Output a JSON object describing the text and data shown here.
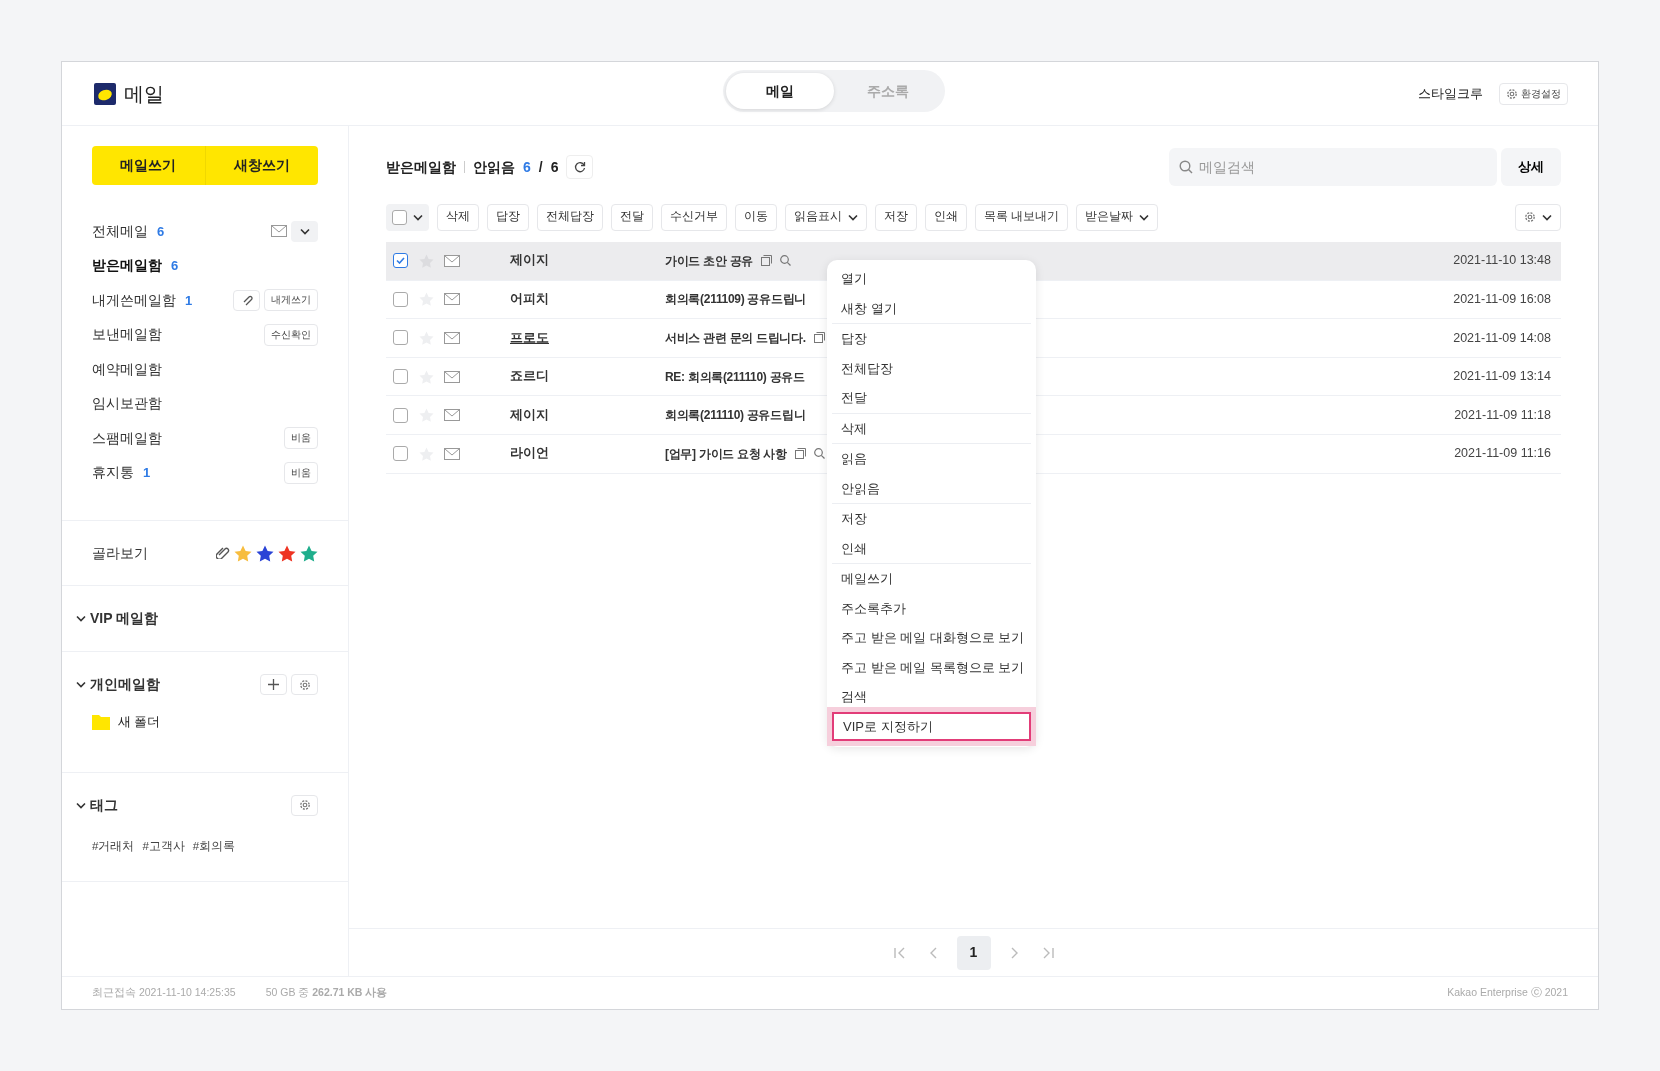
{
  "header": {
    "app_title": "메일",
    "tabs": [
      {
        "label": "메일",
        "selected": true
      },
      {
        "label": "주소록",
        "selected": false
      }
    ],
    "user": "스타일크루",
    "settings_label": "환경설정"
  },
  "sidebar": {
    "compose_buttons": [
      "메일쓰기",
      "새창쓰기"
    ],
    "folders": [
      {
        "name": "전체메일",
        "count": "6",
        "selected": false,
        "actions": [
          {
            "kind": "mail-toggle"
          },
          {
            "kind": "expand"
          }
        ]
      },
      {
        "name": "받은메일함",
        "count": "6",
        "selected": true
      },
      {
        "name": "내게쓴메일함",
        "count": "1",
        "selected": false,
        "actions": [
          {
            "kind": "attach"
          },
          {
            "kind": "text",
            "label": "내게쓰기"
          }
        ]
      },
      {
        "name": "보낸메일함",
        "selected": false,
        "actions": [
          {
            "kind": "text",
            "label": "수신확인"
          }
        ]
      },
      {
        "name": "예약메일함",
        "selected": false
      },
      {
        "name": "임시보관함",
        "selected": false
      },
      {
        "name": "스팸메일함",
        "selected": false,
        "actions": [
          {
            "kind": "text",
            "label": "비움"
          }
        ]
      },
      {
        "name": "휴지통",
        "count": "1",
        "selected": false,
        "actions": [
          {
            "kind": "text",
            "label": "비움"
          }
        ]
      }
    ],
    "filter": {
      "label": "골라보기",
      "stars": [
        {
          "color": "#f7bd3f"
        },
        {
          "color": "#2a43d6"
        },
        {
          "color": "#ee3322"
        },
        {
          "color": "#1fae8c"
        }
      ]
    },
    "sections": [
      {
        "title": "VIP 메일함",
        "expanded": true
      },
      {
        "title": "개인메일함",
        "expanded": true,
        "buttons": [
          {
            "kind": "add"
          },
          {
            "kind": "settings"
          }
        ],
        "folders": [
          "새 폴더"
        ]
      },
      {
        "title": "태그",
        "expanded": true,
        "buttons": [
          {
            "kind": "settings"
          }
        ],
        "tags": [
          "#거래처",
          "#고객사",
          "#회의록"
        ]
      }
    ]
  },
  "mailbox": {
    "title": "받은메일함",
    "unread_label": "안읽음",
    "unread": "6",
    "separator": "/",
    "total": "6"
  },
  "search": {
    "placeholder": "메일검색",
    "detail_button": "상세"
  },
  "toolbar": [
    {
      "label": "삭제",
      "dropdown": false
    },
    {
      "label": "답장",
      "dropdown": false
    },
    {
      "label": "전체답장",
      "dropdown": false
    },
    {
      "label": "전달",
      "dropdown": false
    },
    {
      "label": "수신거부",
      "dropdown": false
    },
    {
      "label": "이동",
      "dropdown": false
    },
    {
      "label": "읽음표시",
      "dropdown": true
    },
    {
      "label": "저장",
      "dropdown": false
    },
    {
      "label": "인쇄",
      "dropdown": false
    },
    {
      "label": "목록 내보내기",
      "dropdown": false
    },
    {
      "label": "받은날짜",
      "dropdown": true
    }
  ],
  "select_all": {
    "checked": false
  },
  "rows": [
    {
      "selected": true,
      "checked": true,
      "sender": "제이지",
      "sender_underlined": false,
      "subject": "가이드 초안 공유",
      "tools": true,
      "date": "2021-11-10 13:48"
    },
    {
      "selected": false,
      "checked": false,
      "sender": "어피치",
      "sender_underlined": false,
      "subject": "회의록(211109) 공유드립니",
      "date": "2021-11-09 16:08"
    },
    {
      "selected": false,
      "checked": false,
      "sender": "프로도",
      "sender_underlined": true,
      "subject": "서비스 관련 문의 드립니다.",
      "tools": true,
      "date": "2021-11-09 14:08"
    },
    {
      "selected": false,
      "checked": false,
      "sender": "죠르디",
      "sender_underlined": false,
      "subject": "RE: 회의록(211110) 공유드",
      "date": "2021-11-09 13:14"
    },
    {
      "selected": false,
      "checked": false,
      "sender": "제이지",
      "sender_underlined": false,
      "subject": "회의록(211110) 공유드립니",
      "date": "2021-11-09 11:18"
    },
    {
      "selected": false,
      "checked": false,
      "sender": "라이언",
      "sender_underlined": false,
      "subject": "[업무] 가이드 요청 사항",
      "tools": true,
      "date": "2021-11-09 11:16"
    }
  ],
  "context_menu": {
    "groups": [
      {
        "items": [
          {
            "label": "열기",
            "selected": false
          },
          {
            "label": "새창 열기",
            "selected": false
          }
        ]
      },
      {
        "items": [
          {
            "label": "답장",
            "selected": false
          },
          {
            "label": "전체답장",
            "selected": false
          },
          {
            "label": "전달",
            "selected": false
          }
        ]
      },
      {
        "items": [
          {
            "label": "삭제",
            "selected": false
          }
        ]
      },
      {
        "items": [
          {
            "label": "읽음",
            "selected": false
          },
          {
            "label": "안읽음",
            "selected": false
          }
        ]
      },
      {
        "items": [
          {
            "label": "저장",
            "selected": false
          },
          {
            "label": "인쇄",
            "selected": false
          }
        ]
      },
      {
        "items": [
          {
            "label": "메일쓰기",
            "selected": false
          },
          {
            "label": "주소록추가",
            "selected": false
          },
          {
            "label": "주고 받은 메일 대화형으로 보기",
            "selected": false
          },
          {
            "label": "주고 받은 메일 목록형으로 보기",
            "selected": false
          },
          {
            "label": "검색",
            "selected": false
          },
          {
            "label": "VIP로 지정하기",
            "selected": true
          }
        ]
      }
    ]
  },
  "pagination": {
    "pages": [
      {
        "label": "1",
        "selected": true
      }
    ]
  },
  "footer": {
    "last_login": "최근접속 2021-11-10 14:25:35",
    "usage": "50 GB 중 **262.71 KB 사용**",
    "copyright": "Kakao Enterprise ⓒ 2021"
  }
}
